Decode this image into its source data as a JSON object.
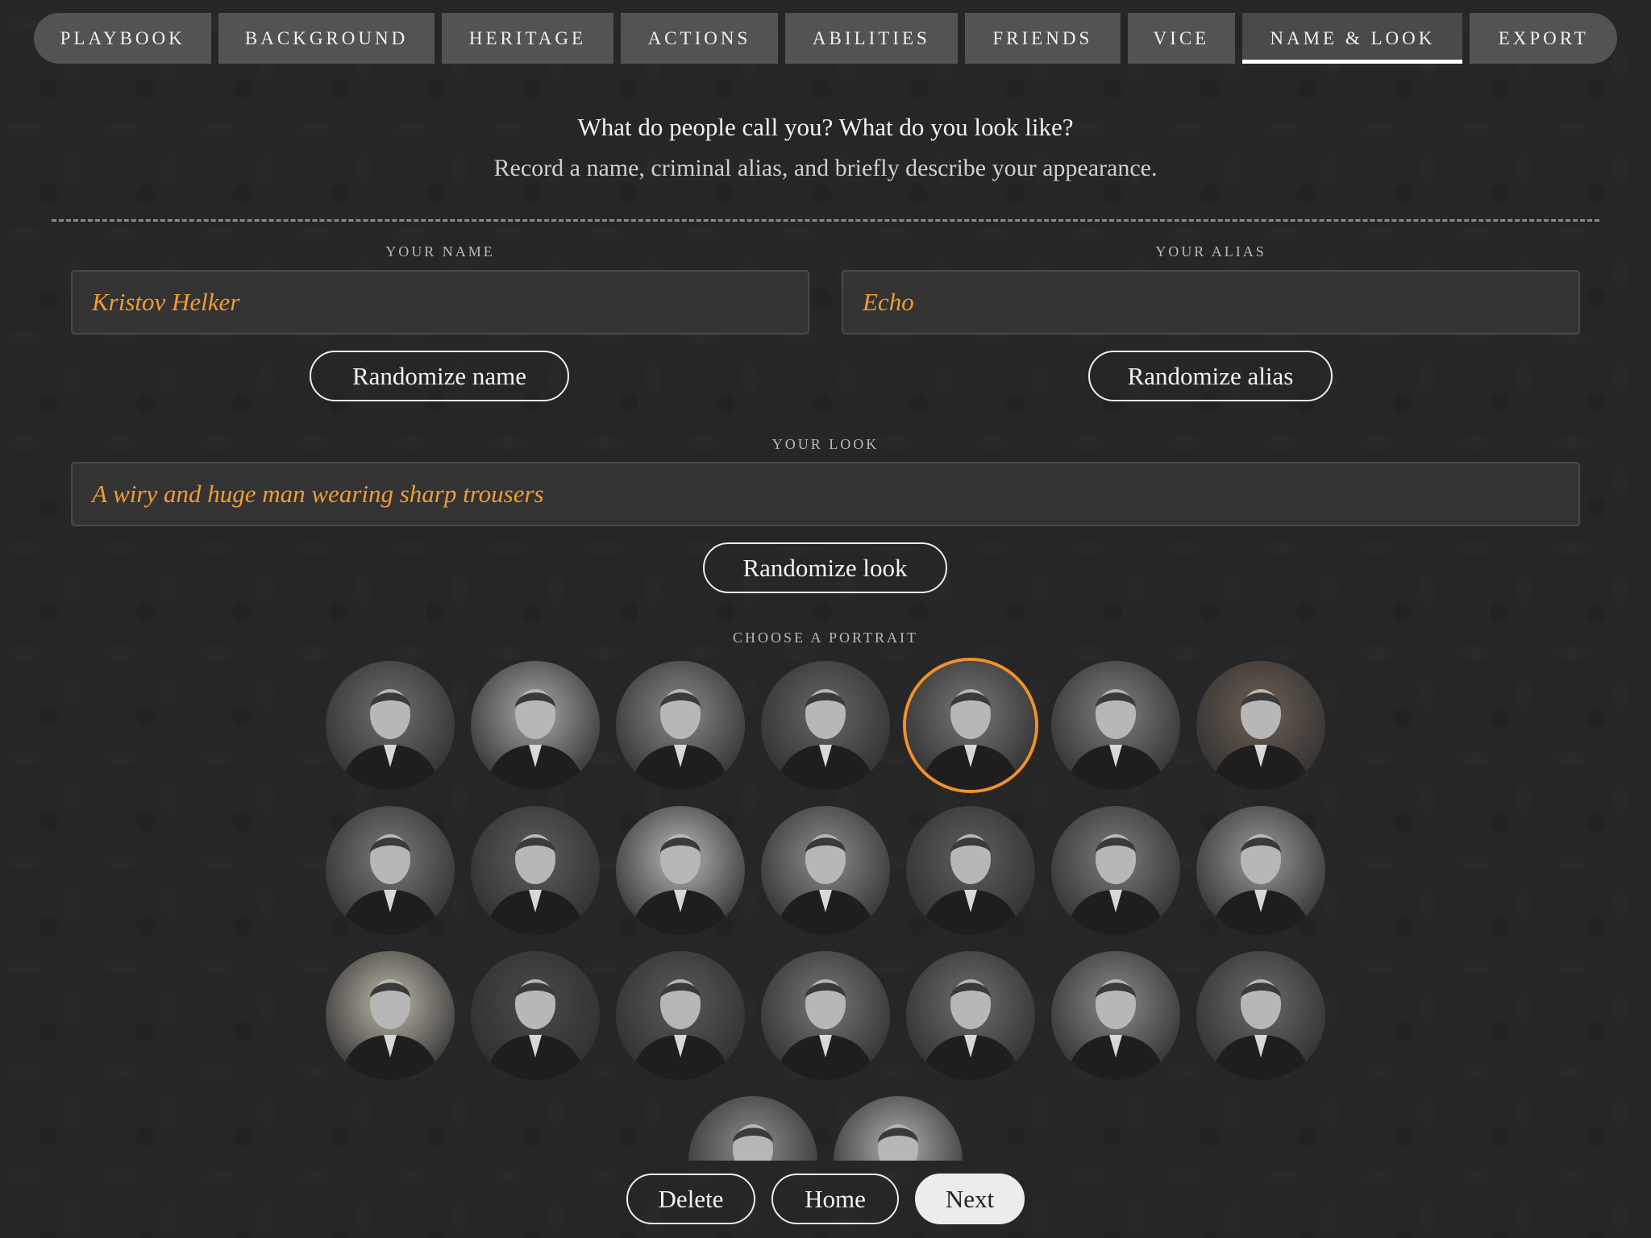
{
  "tabs": [
    {
      "label": "PLAYBOOK",
      "active": false
    },
    {
      "label": "BACKGROUND",
      "active": false
    },
    {
      "label": "HERITAGE",
      "active": false
    },
    {
      "label": "ACTIONS",
      "active": false
    },
    {
      "label": "ABILITIES",
      "active": false
    },
    {
      "label": "FRIENDS",
      "active": false
    },
    {
      "label": "VICE",
      "active": false
    },
    {
      "label": "NAME & LOOK",
      "active": true
    },
    {
      "label": "EXPORT",
      "active": false
    }
  ],
  "intro": {
    "question": "What do people call you? What do you look like?",
    "instruction": "Record a name, criminal alias, and briefly describe your appearance."
  },
  "name": {
    "label": "YOUR NAME",
    "value": "Kristov Helker",
    "button": "Randomize name"
  },
  "alias": {
    "label": "YOUR ALIAS",
    "value": "Echo",
    "button": "Randomize alias"
  },
  "look": {
    "label": "YOUR LOOK",
    "value": "A wiry and huge man wearing sharp trousers",
    "button": "Randomize look"
  },
  "portraits": {
    "label": "CHOOSE A PORTRAIT",
    "selected_index": 4,
    "items": [
      {
        "tone": "#6f6f6f"
      },
      {
        "tone": "#a9a9a9"
      },
      {
        "tone": "#8a8a8a"
      },
      {
        "tone": "#666666"
      },
      {
        "tone": "#777777"
      },
      {
        "tone": "#7f7f7f"
      },
      {
        "tone": "#6e6052"
      },
      {
        "tone": "#7a7a7a"
      },
      {
        "tone": "#5d5d5d"
      },
      {
        "tone": "#b8b8b8"
      },
      {
        "tone": "#8d8d8d"
      },
      {
        "tone": "#5f5f5f"
      },
      {
        "tone": "#7c7c7c"
      },
      {
        "tone": "#9a9a9a"
      },
      {
        "tone": "#bdb8a8"
      },
      {
        "tone": "#4a4a4a"
      },
      {
        "tone": "#5a5a5a"
      },
      {
        "tone": "#777777"
      },
      {
        "tone": "#6d6d6d"
      },
      {
        "tone": "#8a8a8a"
      },
      {
        "tone": "#6a6a6a"
      },
      {
        "tone": "#8e8e8e"
      },
      {
        "tone": "#b0b0b0"
      }
    ]
  },
  "footer": {
    "delete": "Delete",
    "home": "Home",
    "next": "Next"
  },
  "colors": {
    "accent": "#f29b36",
    "selected_ring": "#f0912c"
  }
}
